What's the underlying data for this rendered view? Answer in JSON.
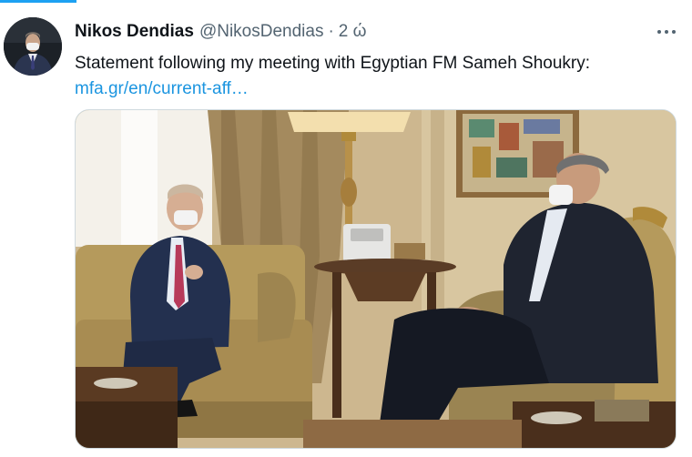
{
  "tweet": {
    "display_name": "Nikos Dendias",
    "handle": "@NikosDendias",
    "separator": "·",
    "time": "2 ώ",
    "text": "Statement following my meeting with Egyptian FM Sameh Shoukry:",
    "link": "mfa.gr/en/current-aff…"
  },
  "icons": {
    "more": "more-horizontal-icon"
  },
  "media": {
    "kind": "photo"
  },
  "colors": {
    "accent": "#1da1f2",
    "link": "#1b95e0",
    "secondary_text": "#536471",
    "primary_text": "#0f1419"
  }
}
